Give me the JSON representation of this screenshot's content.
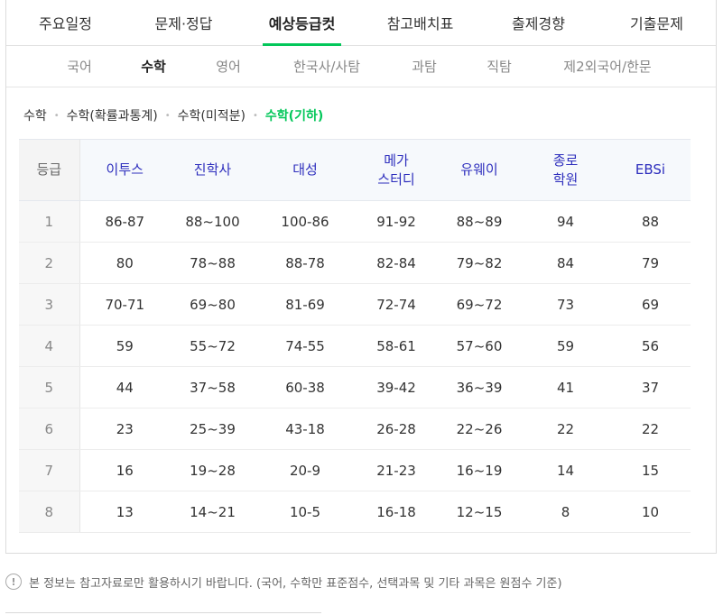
{
  "main_tabs": [
    "주요일정",
    "문제·정답",
    "예상등급컷",
    "참고배치표",
    "출제경향",
    "기출문제"
  ],
  "main_active": 2,
  "sub_tabs": [
    "국어",
    "수학",
    "영어",
    "한국사/사탐",
    "과탐",
    "직탐",
    "제2외국어/한문"
  ],
  "sub_active": 1,
  "breadcrumb": [
    "수학",
    "수학(확률과통계)",
    "수학(미적분)",
    "수학(기하)"
  ],
  "breadcrumb_active": 3,
  "table": {
    "headers": [
      {
        "line1": "등급",
        "line2": ""
      },
      {
        "line1": "이투스",
        "line2": ""
      },
      {
        "line1": "진학사",
        "line2": ""
      },
      {
        "line1": "대성",
        "line2": ""
      },
      {
        "line1": "메가",
        "line2": "스터디"
      },
      {
        "line1": "유웨이",
        "line2": ""
      },
      {
        "line1": "종로",
        "line2": "학원"
      },
      {
        "line1": "EBSi",
        "line2": ""
      }
    ],
    "rows": [
      [
        "1",
        "86-87",
        "88~100",
        "100-86",
        "91-92",
        "88~89",
        "94",
        "88"
      ],
      [
        "2",
        "80",
        "78~88",
        "88-78",
        "82-84",
        "79~82",
        "84",
        "79"
      ],
      [
        "3",
        "70-71",
        "69~80",
        "81-69",
        "72-74",
        "69~72",
        "73",
        "69"
      ],
      [
        "4",
        "59",
        "55~72",
        "74-55",
        "58-61",
        "57~60",
        "59",
        "56"
      ],
      [
        "5",
        "44",
        "37~58",
        "60-38",
        "39-42",
        "36~39",
        "41",
        "37"
      ],
      [
        "6",
        "23",
        "25~39",
        "43-18",
        "26-28",
        "22~26",
        "22",
        "22"
      ],
      [
        "7",
        "16",
        "19~28",
        "20-9",
        "21-23",
        "16~19",
        "14",
        "15"
      ],
      [
        "8",
        "13",
        "14~21",
        "10-5",
        "16-18",
        "12~15",
        "8",
        "10"
      ]
    ]
  },
  "notice": {
    "icon": "!",
    "text": "본 정보는 참고자료로만 활용하시기 바랍니다. (국어, 수학만 표준점수, 선택과목 및 기타 과목은 원점수 기준)"
  },
  "colors": {
    "accent": "#03c75a",
    "header_text": "#2d2ebd"
  }
}
